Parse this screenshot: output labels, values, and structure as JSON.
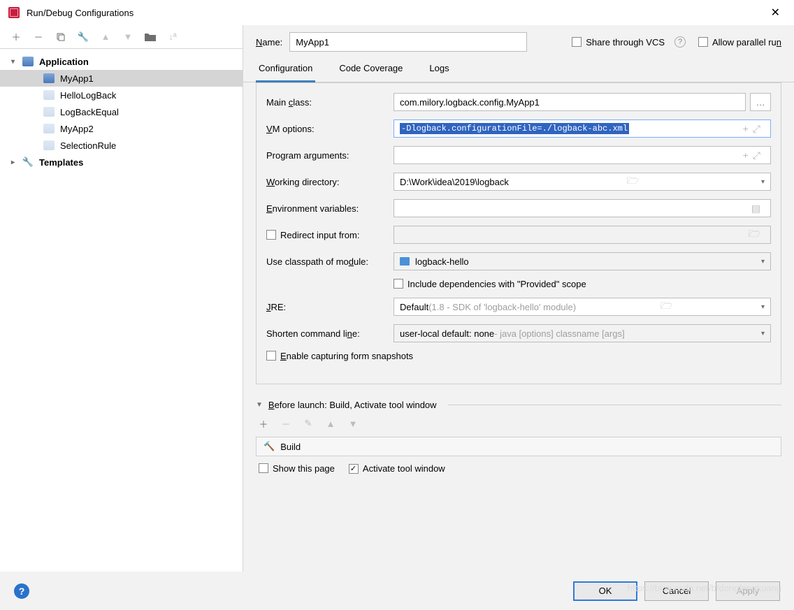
{
  "window": {
    "title": "Run/Debug Configurations"
  },
  "sidebar": {
    "application_label": "Application",
    "templates_label": "Templates",
    "items": [
      {
        "label": "MyApp1"
      },
      {
        "label": "HelloLogBack"
      },
      {
        "label": "LogBackEqual"
      },
      {
        "label": "MyApp2"
      },
      {
        "label": "SelectionRule"
      }
    ]
  },
  "header": {
    "name_label": "Name:",
    "name_value": "MyApp1",
    "share_label": "Share through VCS",
    "allow_parallel_label": "Allow parallel run"
  },
  "tabs": {
    "configuration": "Configuration",
    "coverage": "Code Coverage",
    "logs": "Logs"
  },
  "form": {
    "main_class_label": "Main class:",
    "main_class_value": "com.milory.logback.config.MyApp1",
    "vm_options_label": "VM options:",
    "vm_options_value": "-Dlogback.configurationFile=./logback-abc.xml",
    "program_args_label": "Program arguments:",
    "program_args_value": "",
    "working_dir_label": "Working directory:",
    "working_dir_value": "D:\\Work\\idea\\2019\\logback",
    "env_vars_label": "Environment variables:",
    "env_vars_value": "",
    "redirect_label": "Redirect input from:",
    "classpath_label": "Use classpath of module:",
    "classpath_value": "logback-hello",
    "include_provided_label": "Include dependencies with \"Provided\" scope",
    "jre_label": "JRE:",
    "jre_value": "Default",
    "jre_hint": " (1.8 - SDK of 'logback-hello' module)",
    "shorten_label": "Shorten command line:",
    "shorten_value": "user-local default: none",
    "shorten_hint": " - java [options] classname [args]",
    "enable_snapshots_label": "Enable capturing form snapshots"
  },
  "before_launch": {
    "header": "Before launch: Build, Activate tool window",
    "build_label": "Build",
    "show_page_label": "Show this page",
    "activate_label": "Activate tool window"
  },
  "footer": {
    "ok": "OK",
    "cancel": "Cancel",
    "apply": "Apply"
  },
  "watermark": "https://blog.csdn.net/b/dongfengkuang"
}
